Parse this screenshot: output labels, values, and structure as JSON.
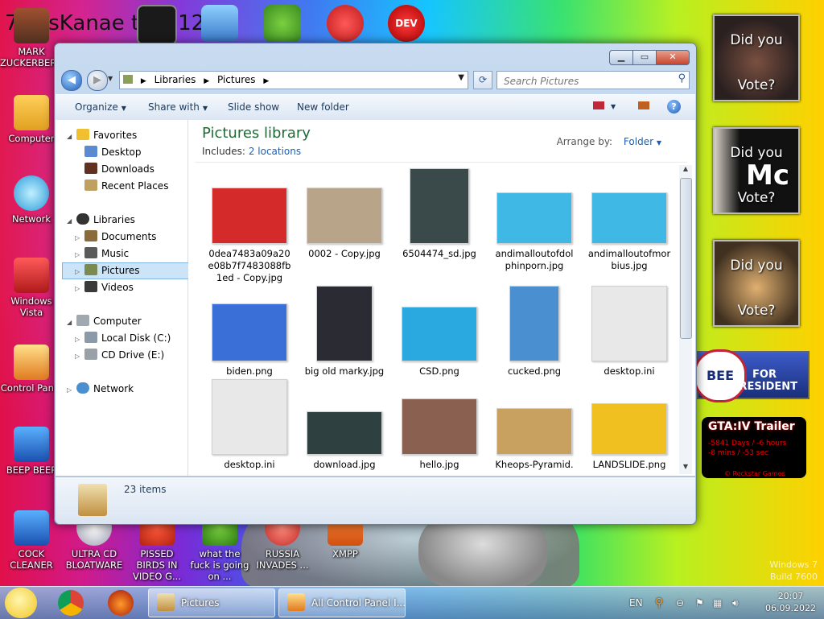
{
  "desktop": {
    "title_text": "7 ossKanae tio 012",
    "icons_left": [
      {
        "label": "MARK ZUCKERBERG"
      },
      {
        "label": "Computer"
      },
      {
        "label": "Network"
      },
      {
        "label": "Windows Vista"
      },
      {
        "label": "Control Panel"
      },
      {
        "label": "BEEP BEEP"
      },
      {
        "label": "COCK CLEANER"
      }
    ],
    "icons_bottom": [
      {
        "label": "ULTRA CD BLOATWARE"
      },
      {
        "label": "PISSED BIRDS IN VIDEO G..."
      },
      {
        "label": "what the fuck is going on ..."
      },
      {
        "label": "RUSSIA INVADES ..."
      },
      {
        "label": "XMPP"
      }
    ],
    "top_icon_labels": [
      "DEV C++"
    ],
    "gadgets": [
      {
        "line1": "Did you",
        "line2": "Vote?"
      },
      {
        "line1": "Did you",
        "line2": "Vote?",
        "overlay": "Mc"
      },
      {
        "line1": "Did you",
        "line2": "Vote?"
      }
    ],
    "bee_banner": {
      "circle": "BEE",
      "text": "FOR PRESIDENT"
    },
    "gta": {
      "title": "GTA:IV Trailer",
      "line1": "-5841 Days / -6 hours",
      "line2": "-8 mins / -53 sec",
      "line3": "© Rockstar Games"
    },
    "watermark": {
      "line1": "Windows 7",
      "line2": "Build 7600"
    }
  },
  "explorer": {
    "breadcrumb": {
      "part1": "Libraries",
      "part2": "Pictures"
    },
    "search_placeholder": "Search Pictures",
    "toolbar": {
      "organize": "Organize",
      "share": "Share with",
      "slideshow": "Slide show",
      "new_folder": "New folder"
    },
    "nav": {
      "favorites": "Favorites",
      "desktop": "Desktop",
      "downloads": "Downloads",
      "recent": "Recent Places",
      "libraries": "Libraries",
      "documents": "Documents",
      "music": "Music",
      "pictures": "Pictures",
      "videos": "Videos",
      "computer": "Computer",
      "local_disk": "Local Disk (C:)",
      "cd_drive": "CD Drive (E:)",
      "network": "Network"
    },
    "library_title": "Pictures library",
    "includes_label": "Includes:",
    "includes_link": "2 locations",
    "arrange_label": "Arrange by:",
    "arrange_value": "Folder",
    "files": [
      {
        "name": "0dea7483a09a20e08b7f7483088fb1ed - Copy.jpg",
        "color": "#d42a2a"
      },
      {
        "name": "0002 - Copy.jpg",
        "color": "#b8a488"
      },
      {
        "name": "6504474_sd.jpg",
        "color": "#3a4a4a"
      },
      {
        "name": "andimalloutofdolphinporn.jpg",
        "color": "#3fb8e6"
      },
      {
        "name": "andimalloutofmorbius.jpg",
        "color": "#3fb8e6"
      },
      {
        "name": "biden.png",
        "color": "#3a6fd8"
      },
      {
        "name": "big old marky.jpg",
        "color": "#2b2b33"
      },
      {
        "name": "CSD.png",
        "color": "#2aa8e0"
      },
      {
        "name": "cucked.png",
        "color": "#4a8fd0"
      },
      {
        "name": "desktop.ini",
        "color": "#e8e8e8"
      },
      {
        "name": "desktop.ini",
        "color": "#e8e8e8"
      },
      {
        "name": "download.jpg",
        "color": "#2e4040"
      },
      {
        "name": "hello.jpg",
        "color": "#8a6050"
      },
      {
        "name": "Kheops-Pyramid.",
        "color": "#c8a060"
      },
      {
        "name": "LANDSLIDE.png",
        "color": "#f0c020"
      }
    ],
    "status_count": "23 items"
  },
  "taskbar": {
    "tasks": [
      {
        "label": "Pictures"
      },
      {
        "label": "All Control Panel I..."
      }
    ],
    "lang": "EN",
    "time": "20:07",
    "date": "06.09.2022"
  }
}
